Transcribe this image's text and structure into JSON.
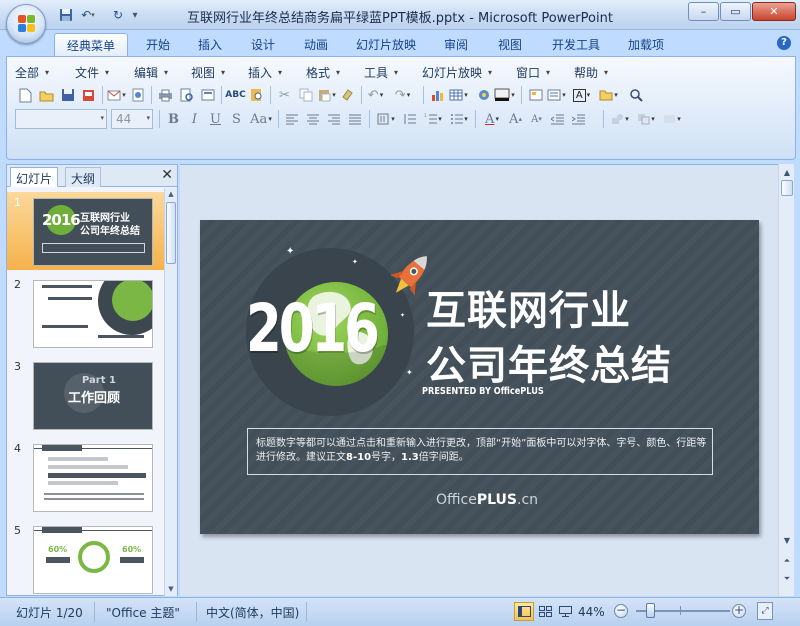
{
  "window": {
    "title": "互联网行业年终总结商务扁平绿蓝PPT模板.pptx - Microsoft PowerPoint",
    "minimize_label": "–",
    "maximize_label": "▭",
    "close_label": "✕"
  },
  "qat": {
    "save_icon": "save-icon",
    "undo_icon": "undo-icon",
    "redo_icon": "redo-icon",
    "customize_label": "▾"
  },
  "tabs": [
    {
      "label": "经典菜单",
      "active": true
    },
    {
      "label": "开始"
    },
    {
      "label": "插入"
    },
    {
      "label": "设计"
    },
    {
      "label": "动画"
    },
    {
      "label": "幻灯片放映"
    },
    {
      "label": "审阅"
    },
    {
      "label": "视图"
    },
    {
      "label": "开发工具"
    },
    {
      "label": "加载项"
    }
  ],
  "help_label": "?",
  "menus": [
    {
      "label": "全部"
    },
    {
      "label": "文件"
    },
    {
      "label": "编辑"
    },
    {
      "label": "视图"
    },
    {
      "label": "插入"
    },
    {
      "label": "格式"
    },
    {
      "label": "工具"
    },
    {
      "label": "幻灯片放映"
    },
    {
      "label": "窗口"
    },
    {
      "label": "帮助"
    }
  ],
  "format_bar": {
    "font_name": "",
    "font_size": "44",
    "bold": "B",
    "italic": "I",
    "underline": "U",
    "strikethrough": "S",
    "change_case": "Aa",
    "font_color": "A",
    "grow_font": "A",
    "shrink_font": "A",
    "text_box": "A"
  },
  "slides_pane": {
    "tab_slides": "幻灯片",
    "tab_outline": "大纲",
    "close_label": "✕",
    "thumbnails": [
      {
        "number": "1",
        "selected": true,
        "year": "2016",
        "line1": "互联网行业",
        "line2": "公司年终总结"
      },
      {
        "number": "2"
      },
      {
        "number": "3",
        "part_label": "Part 1",
        "caption": "工作回顾"
      },
      {
        "number": "4"
      },
      {
        "number": "5",
        "left_pct": "60%",
        "right_pct": "60%"
      }
    ]
  },
  "slide": {
    "year": "2016",
    "title_line1": "互联网行业",
    "title_line2": "公司年终总结",
    "presented_by": "PRESENTED BY OfficePLUS",
    "body_part1": "标题数字等都可以通过点击和重新输入进行更改，顶部“开始”面板中可以对字体、字号、颜色、行距等进行修改。建议正文",
    "body_bold1": "8-10",
    "body_part2": "号字，",
    "body_bold2": "1.3",
    "body_part3": "倍字间距。",
    "footer_light": "Office",
    "footer_bold": "PLUS",
    "footer_suffix": ".cn",
    "background_color": "#424e58",
    "planet_color": "#7ab744",
    "rocket_color": "#e8703a"
  },
  "statusbar": {
    "slide_indicator": "幻灯片 1/20",
    "theme": "\"Office 主题\"",
    "language": "中文(简体，中国)",
    "zoom_level": "44%",
    "zoom_out": "−",
    "zoom_in": "+",
    "zoom_fraction": 0.44
  }
}
